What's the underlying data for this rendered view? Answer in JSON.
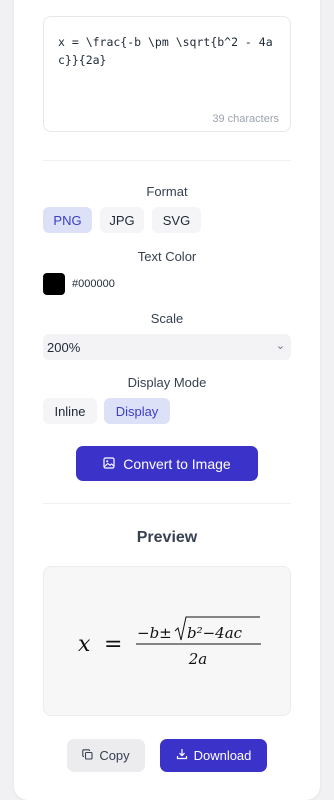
{
  "input": {
    "latex": "x = \\frac{-b \\pm \\sqrt{b^2 - 4ac}}{2a}",
    "char_count": "39 characters"
  },
  "format": {
    "label": "Format",
    "options": [
      "PNG",
      "JPG",
      "SVG"
    ],
    "selected": "PNG"
  },
  "text_color": {
    "label": "Text Color",
    "value": "#000000"
  },
  "scale": {
    "label": "Scale",
    "value": "200%"
  },
  "display_mode": {
    "label": "Display Mode",
    "options": [
      "Inline",
      "Display"
    ],
    "selected": "Display"
  },
  "convert_button": "Convert to Image",
  "preview": {
    "title": "Preview",
    "rendered": {
      "lhs": "x",
      "eq": "=",
      "numerator_pre": "−b±",
      "radicand": "b²−4ac",
      "denominator": "2a"
    }
  },
  "actions": {
    "copy": "Copy",
    "download": "Download"
  },
  "colors": {
    "accent": "#3b33c9",
    "chip_active_bg": "#dde1f7",
    "chip_active_text": "#3b3fc4"
  }
}
